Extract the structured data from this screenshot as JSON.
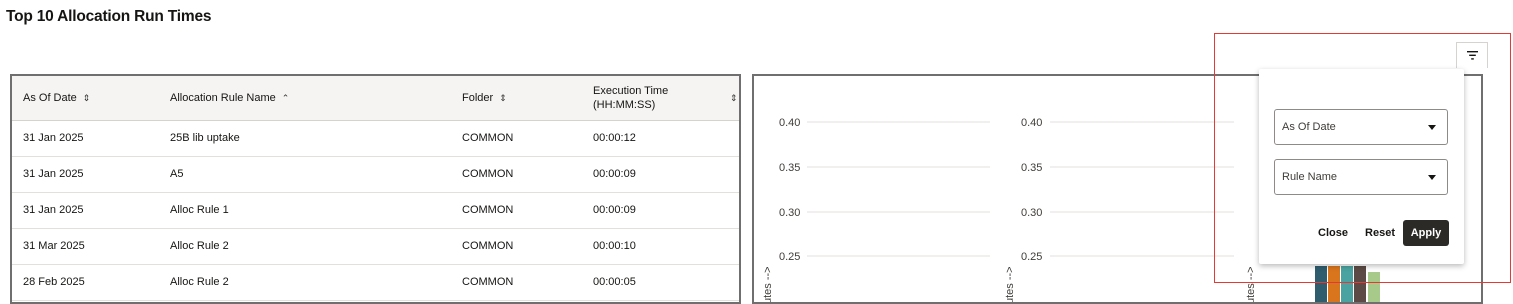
{
  "page": {
    "title": "Top 10 Allocation Run Times"
  },
  "table": {
    "columns": [
      {
        "label": "As Of Date",
        "sort": "⇕"
      },
      {
        "label": "Allocation Rule Name",
        "sort": "⌃"
      },
      {
        "label": "Folder",
        "sort": "⇕"
      },
      {
        "label_line1": "Execution Time",
        "label_line2": "(HH:MM:SS)",
        "sort": "⇕"
      }
    ],
    "rows": [
      {
        "date": "31 Jan 2025",
        "rule": "25B lib uptake",
        "folder": "COMMON",
        "time": "00:00:12"
      },
      {
        "date": "31 Jan 2025",
        "rule": "A5",
        "folder": "COMMON",
        "time": "00:00:09"
      },
      {
        "date": "31 Jan 2025",
        "rule": "Alloc Rule 1",
        "folder": "COMMON",
        "time": "00:00:09"
      },
      {
        "date": "31 Mar 2025",
        "rule": "Alloc Rule 2",
        "folder": "COMMON",
        "time": "00:00:10"
      },
      {
        "date": "28 Feb 2025",
        "rule": "Alloc Rule 2",
        "folder": "COMMON",
        "time": "00:00:05"
      }
    ]
  },
  "chart": {
    "y_ticks": [
      "0.40",
      "0.35",
      "0.30",
      "0.25"
    ],
    "axis_label_fragment": "utes -->",
    "bar_colors": [
      "#2f5d6e",
      "#d9751c",
      "#4aa3a0",
      "#5b4a45",
      "#a7c98a"
    ]
  },
  "filter": {
    "icon": "filter-icon",
    "select_as_of_date": "As Of Date",
    "select_rule_name": "Rule Name",
    "close_label": "Close",
    "reset_label": "Reset",
    "apply_label": "Apply"
  }
}
